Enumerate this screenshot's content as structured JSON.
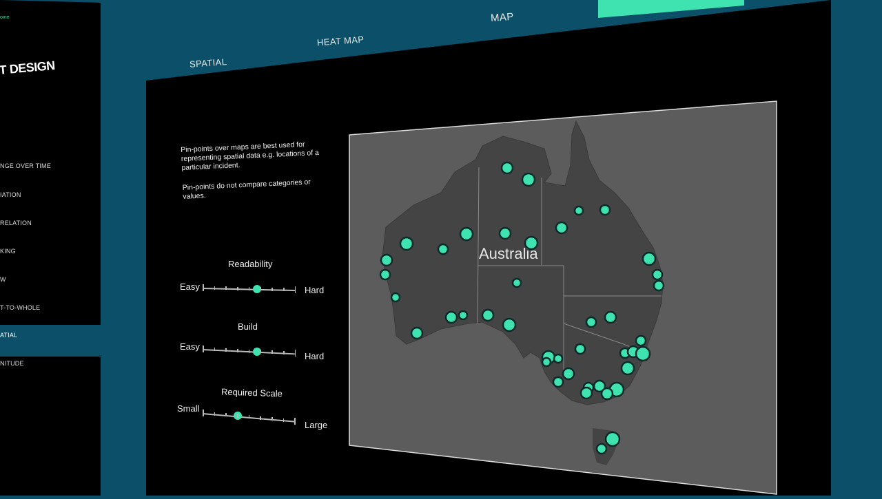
{
  "sidebar": {
    "home": "ome",
    "title": "T DESIGN",
    "items": [
      {
        "label": "NGE OVER TIME"
      },
      {
        "label": "IATION"
      },
      {
        "label": "RELATION"
      },
      {
        "label": "KING"
      },
      {
        "label": "W"
      },
      {
        "label": "T-TO-WHOLE"
      },
      {
        "label": "ATIAL"
      },
      {
        "label": "NITUDE"
      }
    ]
  },
  "tabs": {
    "spatial": "SPATIAL",
    "heat_map": "HEAT MAP",
    "map": "MAP"
  },
  "description": {
    "para1": "Pin-points over maps are best used for representing spatial data e.g. locations of a particular incident.",
    "para2": "Pin-points do not compare categories or values."
  },
  "sliders": [
    {
      "title": "Readability",
      "low": "Easy",
      "high": "Hard",
      "value": 0.59
    },
    {
      "title": "Build",
      "low": "Easy",
      "high": "Hard",
      "value": 0.59
    },
    {
      "title": "Required Scale",
      "low": "Small",
      "high": "Large",
      "value": 0.38
    }
  ],
  "map": {
    "label": "Australia",
    "colors": {
      "pin": "#3ee3b0",
      "land": "#4a4a4a",
      "sea": "#5c5c5c"
    }
  },
  "colors": {
    "accent": "#3ee3b0",
    "frame": "#0b5068",
    "panel": "#000000"
  }
}
